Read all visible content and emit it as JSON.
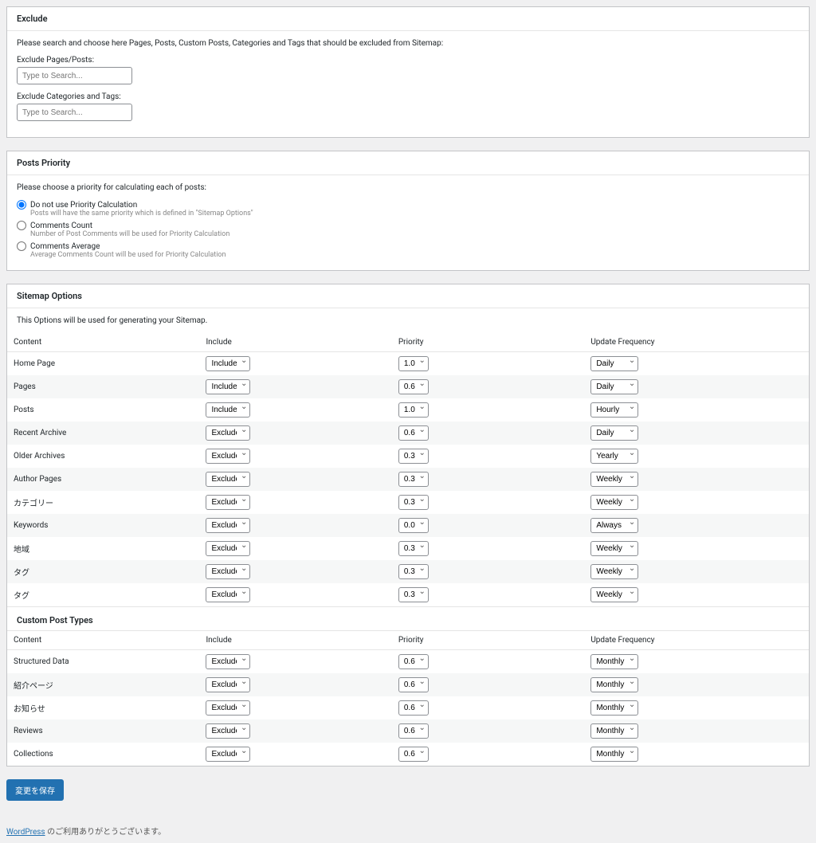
{
  "exclude": {
    "title": "Exclude",
    "desc": "Please search and choose here Pages, Posts, Custom Posts, Categories and Tags that should be excluded from Sitemap:",
    "pagesLabel": "Exclude Pages/Posts:",
    "catsLabel": "Exclude Categories and Tags:",
    "placeholder": "Type to Search..."
  },
  "priority": {
    "title": "Posts Priority",
    "desc": "Please choose a priority for calculating each of posts:",
    "opts": [
      {
        "label": "Do not use Priority Calculation",
        "hint": "Posts will have the same priority which is defined in \"Sitemap Options\"",
        "checked": true
      },
      {
        "label": "Comments Count",
        "hint": "Number of Post Comments will be used for Priority Calculation",
        "checked": false
      },
      {
        "label": "Comments Average",
        "hint": "Average Comments Count will be used for Priority Calculation",
        "checked": false
      }
    ]
  },
  "sitemap": {
    "title": "Sitemap Options",
    "desc": "This Options will be used for generating your Sitemap.",
    "cols": {
      "content": "Content",
      "include": "Include",
      "priority": "Priority",
      "freq": "Update Frequency"
    },
    "rows": [
      {
        "content": "Home Page",
        "include": "Include",
        "priority": "1.0",
        "freq": "Daily"
      },
      {
        "content": "Pages",
        "include": "Include",
        "priority": "0.6",
        "freq": "Daily"
      },
      {
        "content": "Posts",
        "include": "Include",
        "priority": "1.0",
        "freq": "Hourly"
      },
      {
        "content": "Recent Archive",
        "include": "Exclude",
        "priority": "0.6",
        "freq": "Daily"
      },
      {
        "content": "Older Archives",
        "include": "Exclude",
        "priority": "0.3",
        "freq": "Yearly"
      },
      {
        "content": "Author Pages",
        "include": "Exclude",
        "priority": "0.3",
        "freq": "Weekly"
      },
      {
        "content": "カテゴリー",
        "include": "Exclude",
        "priority": "0.3",
        "freq": "Weekly"
      },
      {
        "content": "Keywords",
        "include": "Exclude",
        "priority": "0.0",
        "freq": "Always"
      },
      {
        "content": "地域",
        "include": "Exclude",
        "priority": "0.3",
        "freq": "Weekly"
      },
      {
        "content": "タグ",
        "include": "Exclude",
        "priority": "0.3",
        "freq": "Weekly"
      },
      {
        "content": "タグ",
        "include": "Exclude",
        "priority": "0.3",
        "freq": "Weekly"
      }
    ]
  },
  "custom": {
    "title": "Custom Post Types",
    "rows": [
      {
        "content": "Structured Data",
        "include": "Exclude",
        "priority": "0.6",
        "freq": "Monthly"
      },
      {
        "content": "紹介ページ",
        "include": "Exclude",
        "priority": "0.6",
        "freq": "Monthly"
      },
      {
        "content": "お知らせ",
        "include": "Exclude",
        "priority": "0.6",
        "freq": "Monthly"
      },
      {
        "content": "Reviews",
        "include": "Exclude",
        "priority": "0.6",
        "freq": "Monthly"
      },
      {
        "content": "Collections",
        "include": "Exclude",
        "priority": "0.6",
        "freq": "Monthly"
      }
    ]
  },
  "save": "変更を保存",
  "footer": {
    "link": "WordPress",
    "text": " のご利用ありがとうございます。"
  }
}
